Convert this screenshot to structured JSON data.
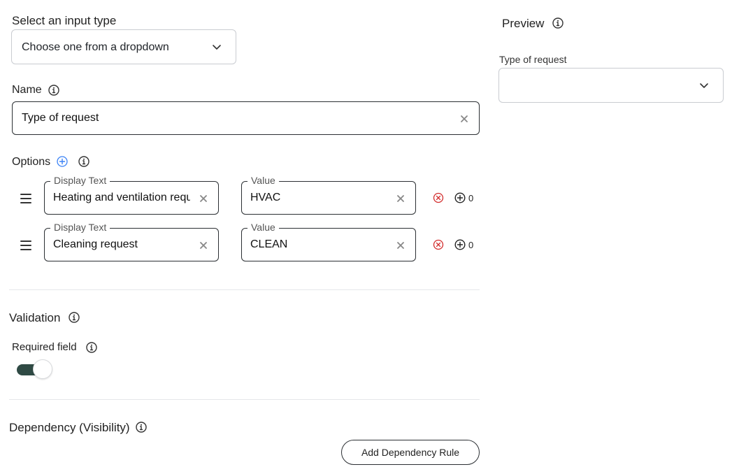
{
  "input_type": {
    "label": "Select an input type",
    "selected": "Choose one from a dropdown"
  },
  "name": {
    "label": "Name",
    "value": "Type of request"
  },
  "options": {
    "label": "Options",
    "items": [
      {
        "display_legend": "Display Text",
        "display_value": "Heating and ventilation requ",
        "value_legend": "Value",
        "value": "HVAC",
        "count": "0"
      },
      {
        "display_legend": "Display Text",
        "display_value": "Cleaning request",
        "value_legend": "Value",
        "value": "CLEAN",
        "count": "0"
      }
    ]
  },
  "validation": {
    "title": "Validation",
    "required_label": "Required field",
    "required_on": true
  },
  "dependency": {
    "title": "Dependency (Visibility)",
    "add_rule_label": "Add Dependency Rule"
  },
  "preview": {
    "title": "Preview",
    "field_label": "Type of request",
    "field_value": ""
  },
  "colors": {
    "accent_blue": "#3b82f6",
    "remove_red": "#d32f2f",
    "toggle_track": "#2f4a44"
  }
}
